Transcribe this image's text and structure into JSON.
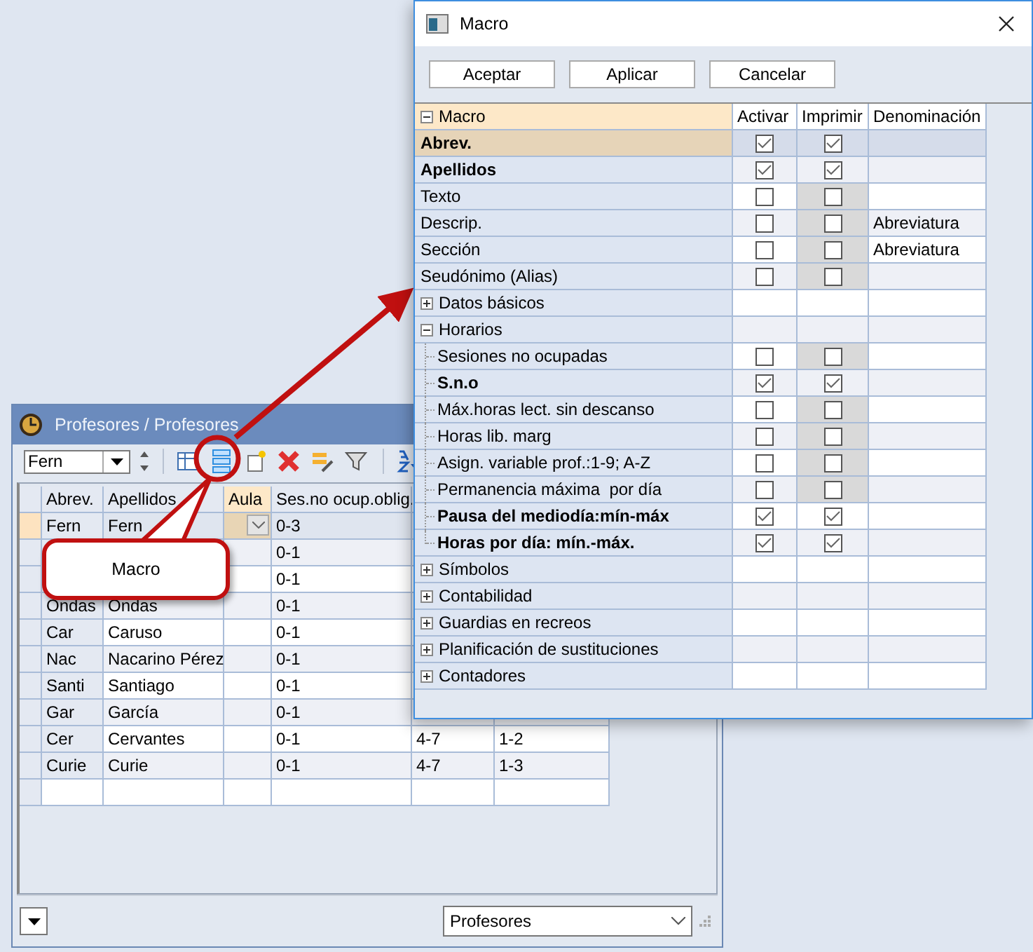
{
  "back_window": {
    "title": "Profesores / Profesores",
    "selector": {
      "value": "Fern"
    },
    "table": {
      "columns": [
        "Abrev.",
        "Apellidos",
        "Aula",
        "Ses.no ocup.oblig."
      ],
      "rows": [
        {
          "selected": true,
          "cells": {
            "abrev": "Fern",
            "apellidos": "Fern",
            "ses": "0-3"
          }
        },
        {
          "selected": false,
          "cells": {
            "ses": "0-1"
          }
        },
        {
          "selected": false,
          "cells": {
            "ses": "0-1"
          }
        },
        {
          "selected": false,
          "cells": {
            "abrev": "Ondas",
            "apellidos": "Ondas",
            "ses": "0-1"
          }
        },
        {
          "selected": false,
          "cells": {
            "abrev": "Car",
            "apellidos": "Caruso",
            "ses": "0-1"
          }
        },
        {
          "selected": false,
          "cells": {
            "abrev": "Nac",
            "apellidos": "Nacarino Pérez",
            "ses": "0-1"
          }
        },
        {
          "selected": false,
          "cells": {
            "abrev": "Santi",
            "apellidos": "Santiago",
            "ses": "0-1"
          }
        },
        {
          "selected": false,
          "cells": {
            "abrev": "Gar",
            "apellidos": "García",
            "ses": "0-1"
          }
        },
        {
          "selected": false,
          "cells": {
            "abrev": "Cer",
            "apellidos": "Cervantes",
            "ses": "0-1",
            "column_5": "4-7",
            "column_6": "1-2"
          }
        },
        {
          "selected": false,
          "cells": {
            "abrev": "Curie",
            "apellidos": "Curie",
            "ses": "0-1",
            "column_5": "4-7",
            "column_6": "1-3"
          }
        },
        {
          "selected": false,
          "cells": {}
        }
      ]
    },
    "footer_select": {
      "value": "Profesores"
    }
  },
  "callout": {
    "text": "Macro"
  },
  "dialog": {
    "title": "Macro",
    "buttons": [
      "Aceptar",
      "Aplicar",
      "Cancelar"
    ],
    "tree": {
      "root": {
        "label": "Macro",
        "expanded": true
      },
      "columns": [
        "Activar",
        "Imprimir",
        "Denominación"
      ],
      "items": [
        {
          "kind": "field",
          "label": "Abrev.",
          "bold": true,
          "selected": true,
          "activar": true,
          "imprimir": true,
          "imprimir_disabled": false
        },
        {
          "kind": "field",
          "label": "Apellidos",
          "bold": true,
          "selected": false,
          "activar": true,
          "imprimir": true,
          "imprimir_disabled": false
        },
        {
          "kind": "field",
          "label": "Texto",
          "bold": false,
          "selected": false,
          "activar": false,
          "imprimir": false,
          "imprimir_disabled": true
        },
        {
          "kind": "field",
          "label": "Descrip.",
          "bold": false,
          "selected": false,
          "activar": false,
          "imprimir": false,
          "imprimir_disabled": true,
          "denominacion": "Abreviatura"
        },
        {
          "kind": "field",
          "label": "Sección",
          "bold": false,
          "selected": false,
          "activar": false,
          "imprimir": false,
          "imprimir_disabled": true,
          "denominacion": "Abreviatura"
        },
        {
          "kind": "field",
          "label": "Seudónimo (Alias)",
          "bold": false,
          "selected": false,
          "activar": false,
          "imprimir": false,
          "imprimir_disabled": true
        },
        {
          "kind": "group",
          "label": "Datos básicos",
          "selected": false,
          "expanded": false
        },
        {
          "kind": "group",
          "label": "Horarios",
          "selected": false,
          "expanded": true,
          "children": [
            {
              "kind": "field",
              "label": "Sesiones no ocupadas",
              "bold": false,
              "selected": false,
              "activar": false,
              "imprimir": false,
              "imprimir_disabled": true
            },
            {
              "kind": "field",
              "label": "S.n.o",
              "bold": true,
              "selected": false,
              "activar": true,
              "imprimir": true,
              "imprimir_disabled": false
            },
            {
              "kind": "field",
              "label": "Máx.horas lect. sin descanso",
              "bold": false,
              "selected": false,
              "activar": false,
              "imprimir": false,
              "imprimir_disabled": true
            },
            {
              "kind": "field",
              "label": "Horas lib. marg",
              "bold": false,
              "selected": false,
              "activar": false,
              "imprimir": false,
              "imprimir_disabled": true
            },
            {
              "kind": "field",
              "label": "Asign. variable prof.:1-9; A-Z",
              "bold": false,
              "selected": false,
              "activar": false,
              "imprimir": false,
              "imprimir_disabled": true
            },
            {
              "kind": "field",
              "label": "Permanencia máxima  por día",
              "bold": false,
              "selected": false,
              "activar": false,
              "imprimir": false,
              "imprimir_disabled": true
            },
            {
              "kind": "field",
              "label": "Pausa del mediodía:mín-máx",
              "bold": true,
              "selected": false,
              "activar": true,
              "imprimir": true,
              "imprimir_disabled": false
            },
            {
              "kind": "field",
              "label": "Horas por día: mín.-máx.",
              "bold": true,
              "selected": false,
              "activar": true,
              "imprimir": true,
              "imprimir_disabled": false
            }
          ]
        },
        {
          "kind": "group",
          "label": "Símbolos",
          "selected": false,
          "expanded": false
        },
        {
          "kind": "group",
          "label": "Contabilidad",
          "selected": false,
          "expanded": false
        },
        {
          "kind": "group",
          "label": "Guardias en recreos",
          "selected": false,
          "expanded": false
        },
        {
          "kind": "group",
          "label": "Planificación de sustituciones",
          "selected": false,
          "expanded": false
        },
        {
          "kind": "group",
          "label": "Contadores",
          "selected": false,
          "expanded": false
        }
      ]
    }
  }
}
